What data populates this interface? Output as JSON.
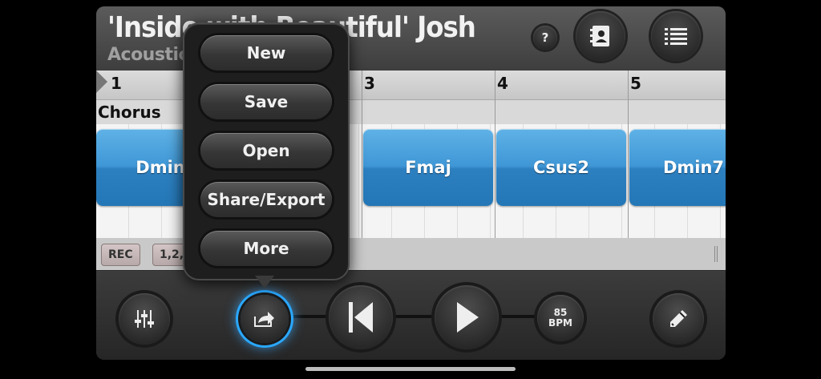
{
  "header": {
    "song_title": "'Inside with Beautiful' Josh",
    "song_subtitle": "Acoustic 1",
    "help_label": "?"
  },
  "timeline": {
    "bar_numbers": [
      "1",
      "3",
      "4",
      "5"
    ],
    "section_label": "Chorus"
  },
  "chords": [
    {
      "label": "Dmin"
    },
    {
      "label": "Fmaj"
    },
    {
      "label": "Csus2"
    },
    {
      "label": "Dmin7"
    }
  ],
  "record_bar": {
    "rec_label": "REC",
    "count_in_label": "1,2,3"
  },
  "toolbar": {
    "bpm_value": "85",
    "bpm_unit": "BPM"
  },
  "share_menu": {
    "items": [
      "New",
      "Save",
      "Open",
      "Share/Export",
      "More"
    ]
  },
  "icons": {
    "help": "question-icon",
    "contacts": "address-book-icon",
    "list": "list-icon",
    "mixer": "mixer-sliders-icon",
    "share": "share-export-icon",
    "prev": "skip-to-start-icon",
    "play": "play-icon",
    "edit": "pencil-icon"
  },
  "colors": {
    "chord_block": "#3f97d6",
    "share_glow": "#2aa8ff"
  }
}
